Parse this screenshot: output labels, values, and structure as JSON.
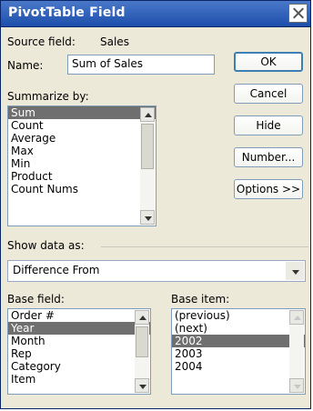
{
  "title": "PivotTable Field",
  "source": {
    "label": "Source field:",
    "value": "Sales"
  },
  "name": {
    "label": "Name:",
    "value": "Sum of Sales"
  },
  "summarize": {
    "label": "Summarize by:",
    "items": [
      "Sum",
      "Count",
      "Average",
      "Max",
      "Min",
      "Product",
      "Count Nums"
    ],
    "selected": "Sum"
  },
  "buttons": {
    "ok": "OK",
    "cancel": "Cancel",
    "hide": "Hide",
    "number": "Number...",
    "options": "Options >>"
  },
  "show_data_as": {
    "label": "Show data as:",
    "value": "Difference From"
  },
  "base_field": {
    "label": "Base field:",
    "items": [
      "Order #",
      "Year",
      "Month",
      "Rep",
      "Category",
      "Item"
    ],
    "selected": "Year"
  },
  "base_item": {
    "label": "Base item:",
    "items": [
      "(previous)",
      "(next)",
      "2002",
      "2003",
      "2004"
    ],
    "selected": "2002"
  },
  "icons": {
    "close": "close-icon",
    "dropdown": "chevron-down-icon"
  }
}
